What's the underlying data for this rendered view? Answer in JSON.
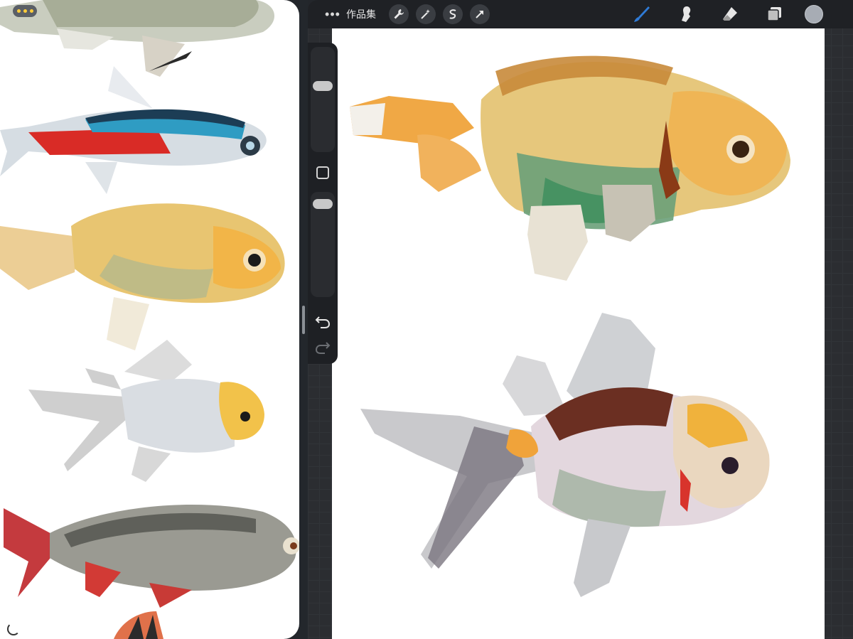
{
  "reference_app": {
    "menu_icon": "three-dots-icon",
    "accent_dots": "#ffcd3a",
    "images": [
      "fish-1",
      "neon-tetra",
      "ranchu-goldfish",
      "oranda-goldfish",
      "roach-fish",
      "fish-6"
    ]
  },
  "toolbar": {
    "more_icon": "more-dots-icon",
    "gallery_label": "作品集",
    "actions": [
      "wrench-icon",
      "magic-wand-icon",
      "selection-icon",
      "transform-arrow-icon"
    ],
    "tools": [
      "brush-icon",
      "smudge-icon",
      "eraser-icon",
      "layers-icon"
    ],
    "active_tool": "brush-icon",
    "active_color": "#a7acb4",
    "accent": "#2f7bd6"
  },
  "sidebar": {
    "controls": [
      "brush-size-slider",
      "modify-button",
      "opacity-slider",
      "undo-icon",
      "redo-icon"
    ]
  }
}
